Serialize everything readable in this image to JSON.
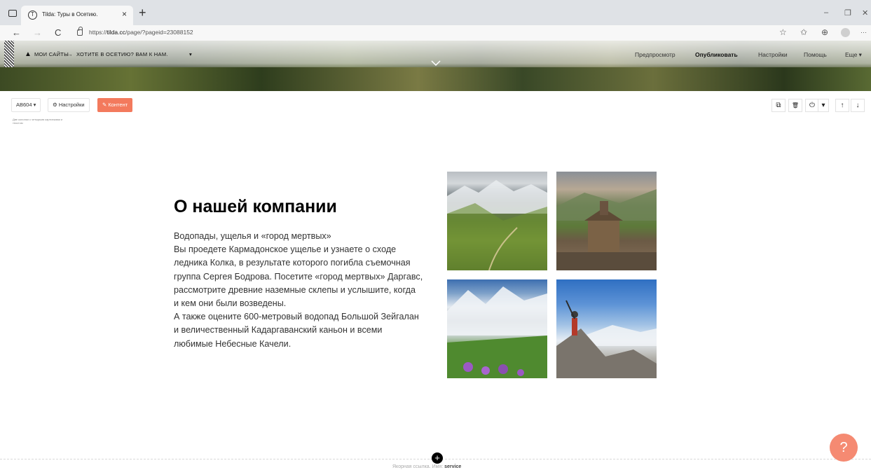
{
  "browser": {
    "tab_title": "Tilda: Туры в Осетию.",
    "tab_close": "×",
    "new_tab": "+",
    "url_prefix": "https://",
    "url_domain": "tilda.cc",
    "url_path": "/page/?pageid=23088152",
    "back": "←",
    "forward": "→",
    "reload": "C",
    "window_min": "–",
    "window_restore": "❐",
    "window_close": "✕",
    "more": "···"
  },
  "topnav": {
    "home_icon": "home-icon",
    "breadcrumb_sites": "МОИ САЙТЫ",
    "breadcrumb_sep": "→",
    "breadcrumb_page": "ХОТИТЕ В ОСЕТИЮ? ВАМ К НАМ.",
    "breadcrumb_caret": "▾",
    "preview": "Предпросмотр",
    "publish": "Опубликовать",
    "settings": "Настройки",
    "help": "Помощь",
    "more": "Еще ▾"
  },
  "block_toolbar": {
    "block_id": "AB604 ▾",
    "settings": "Настройки",
    "content": "Контент",
    "description": "Две колонки с четырьмя картинками и текстом"
  },
  "block_controls": [
    "⧉",
    "🗑",
    "⏻",
    "▾",
    "↑",
    "↓"
  ],
  "content": {
    "heading": "О нашей компании",
    "paragraph_lines": [
      "Водопады, ущелья и «город мертвых»",
      "Вы проедете Кармадонское ущелье и узнаете о сходе",
      "ледника Колка, в результате которого погибла съемочная",
      "группа Сергея Бодрова. Посетите «город мертвых» Даргавс,",
      "рассмотрите древние наземные склепы и услышите, когда",
      "и кем они были возведены.",
      "А также оцените 600-метровый водопад Большой Зейгалан",
      "и величественный Кадаргаванский каньон и всеми",
      "любимые Небесные Качели."
    ]
  },
  "photos": [
    "mountain-valley-photo",
    "church-village-photo",
    "snowy-peaks-flowers-photo",
    "hiker-summit-photo"
  ],
  "footer": {
    "add_block": "+",
    "label": "Якорная ссылка. Имя:",
    "anchor_name": "service",
    "help": "?"
  },
  "colors": {
    "accent": "#f37a5d",
    "help_button": "#f58a72"
  }
}
